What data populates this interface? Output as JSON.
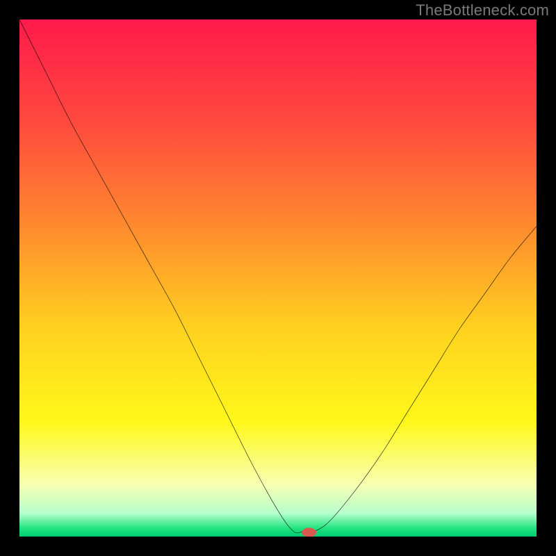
{
  "watermark": "TheBottleneck.com",
  "chart_data": {
    "type": "line",
    "title": "",
    "xlabel": "",
    "ylabel": "",
    "xlim": [
      0,
      100
    ],
    "ylim": [
      0,
      100
    ],
    "grid": false,
    "legend": false,
    "background": {
      "type": "vertical-gradient",
      "stops": [
        {
          "pos": 0.0,
          "color": "#ff1a4b"
        },
        {
          "pos": 0.2,
          "color": "#ff4a3e"
        },
        {
          "pos": 0.4,
          "color": "#ff8a2e"
        },
        {
          "pos": 0.6,
          "color": "#ffd21f"
        },
        {
          "pos": 0.78,
          "color": "#fff81a"
        },
        {
          "pos": 0.9,
          "color": "#f7ffb3"
        },
        {
          "pos": 0.955,
          "color": "#b6ffcc"
        },
        {
          "pos": 0.985,
          "color": "#1de27e"
        },
        {
          "pos": 1.0,
          "color": "#00ce72"
        }
      ]
    },
    "series": [
      {
        "name": "bottleneck-curve",
        "color": "#000000",
        "x": [
          0,
          5,
          10,
          15,
          20,
          25,
          30,
          35,
          40,
          45,
          50,
          53,
          55,
          57,
          60,
          65,
          70,
          75,
          80,
          85,
          90,
          95,
          100
        ],
        "y": [
          100,
          90,
          80,
          71,
          62,
          53,
          44,
          34,
          24,
          14,
          5,
          1,
          1,
          1,
          3,
          9,
          16,
          24,
          32,
          40,
          47,
          54,
          60
        ]
      }
    ],
    "marker": {
      "name": "min-point",
      "x": 56,
      "y": 0.8,
      "color": "#d95a4e",
      "rx": 1.4,
      "ry": 0.9
    }
  }
}
